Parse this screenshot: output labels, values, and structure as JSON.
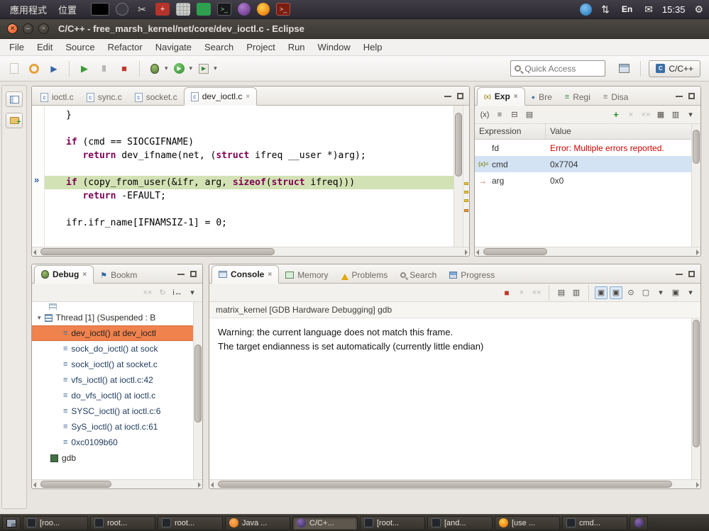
{
  "icons": {
    "cross": "×",
    "caret": "▾",
    "plus": "+",
    "stop": "■",
    "bars": "≡",
    "dot": "●",
    "arrowr": "→",
    "flag": "⚑",
    "gear": "⚙",
    "scissors": "✂",
    "mail": "✉",
    "updown": "⇅",
    "play": "▶",
    "pause": "‖",
    "restart": "↻",
    "istep": "i↔",
    "chevrons": "»",
    "xtype": "(x)",
    "doublecross": "××",
    "expty": "(x)="
  },
  "top_panel": {
    "applications_label": "應用程式",
    "places_label": "位置",
    "keyboard_indicator": "En",
    "clock": "15:35"
  },
  "titlebar": {
    "title": "C/C++ - free_marsh_kernel/net/core/dev_ioctl.c - Eclipse"
  },
  "menubar": {
    "items": [
      "File",
      "Edit",
      "Source",
      "Refactor",
      "Navigate",
      "Search",
      "Project",
      "Run",
      "Window",
      "Help"
    ]
  },
  "toolbar": {
    "quick_access_placeholder": "Quick Access",
    "perspective_label": "C/C++"
  },
  "editor": {
    "tabs": [
      {
        "label": "ioctl.c"
      },
      {
        "label": "sync.c"
      },
      {
        "label": "socket.c"
      },
      {
        "label": "dev_ioctl.c",
        "cls": "active"
      }
    ],
    "code": [
      {
        "segs": [
          {
            "s": "}"
          }
        ]
      },
      {
        "segs": []
      },
      {
        "segs": [
          {
            "k": 1,
            "s": "if"
          },
          {
            "s": " (cmd == SIOCGIFNAME)"
          }
        ]
      },
      {
        "segs": [
          {
            "s": "   "
          },
          {
            "k": 1,
            "s": "return"
          },
          {
            "s": " dev_ifname(net, ("
          },
          {
            "k": 1,
            "s": "struct"
          },
          {
            "s": " ifreq __user *)arg);"
          }
        ]
      },
      {
        "segs": []
      },
      {
        "hl": 1,
        "segs": [
          {
            "k": 1,
            "s": "if"
          },
          {
            "s": " (copy_from_user(&ifr, arg, "
          },
          {
            "k": 1,
            "s": "sizeof"
          },
          {
            "s": "("
          },
          {
            "k": 1,
            "s": "struct"
          },
          {
            "s": " ifreq)))"
          }
        ]
      },
      {
        "segs": [
          {
            "s": "   "
          },
          {
            "k": 1,
            "s": "return"
          },
          {
            "s": " -EFAULT;"
          }
        ]
      },
      {
        "segs": []
      },
      {
        "segs": [
          {
            "s": "ifr.ifr_name[IFNAMSIZ-1] = 0;"
          }
        ]
      }
    ]
  },
  "expressions": {
    "tabs": [
      "Exp",
      "Bre",
      "Regi",
      "Disa"
    ],
    "columns": [
      "Expression",
      "Value"
    ],
    "rows": [
      {
        "icon": "",
        "name": "fd",
        "value": "Error: Multiple errors reported.",
        "cls": "error"
      },
      {
        "icon": "(x)=",
        "name": "cmd",
        "value": "0x7704",
        "cls": "selected"
      },
      {
        "icon": "→",
        "name": "arg",
        "value": "0x0",
        "cls": "ptr"
      }
    ]
  },
  "debug": {
    "tabs": [
      "Debug",
      "Bookm"
    ],
    "thread_label": "Thread [1] (Suspended : B",
    "frames": [
      {
        "label": "dev_ioctl() at dev_ioctl",
        "cls": "selected"
      },
      {
        "label": "sock_do_ioctl() at sock"
      },
      {
        "label": "sock_ioctl() at socket.c"
      },
      {
        "label": "vfs_ioctl() at ioctl.c:42"
      },
      {
        "label": "do_vfs_ioctl() at ioctl.c"
      },
      {
        "label": "SYSC_ioctl() at ioctl.c:6"
      },
      {
        "label": "SyS_ioctl() at ioctl.c:61"
      },
      {
        "label": "0xc0109b60"
      }
    ],
    "gdb_label": "gdb"
  },
  "console": {
    "tabs": [
      "Console",
      "Memory",
      "Problems",
      "Search",
      "Progress"
    ],
    "header": "matrix_kernel [GDB Hardware Debugging] gdb",
    "lines": [
      "Warning: the current language does not match this frame.",
      "The target endianness is set automatically (currently little endian)"
    ]
  },
  "taskbar": {
    "items": [
      {
        "label": "[roo...",
        "icon": "terminal"
      },
      {
        "label": "root...",
        "icon": "terminal"
      },
      {
        "label": "root...",
        "icon": "terminal"
      },
      {
        "label": "Java ...",
        "icon": "java"
      },
      {
        "label": "C/C+...",
        "icon": "eclipse",
        "cls": "active"
      },
      {
        "label": "[root...",
        "icon": "terminal"
      },
      {
        "label": "[and...",
        "icon": "terminal"
      },
      {
        "label": "[use ...",
        "icon": "firefox"
      },
      {
        "label": "cmd...",
        "icon": "terminal"
      }
    ]
  }
}
